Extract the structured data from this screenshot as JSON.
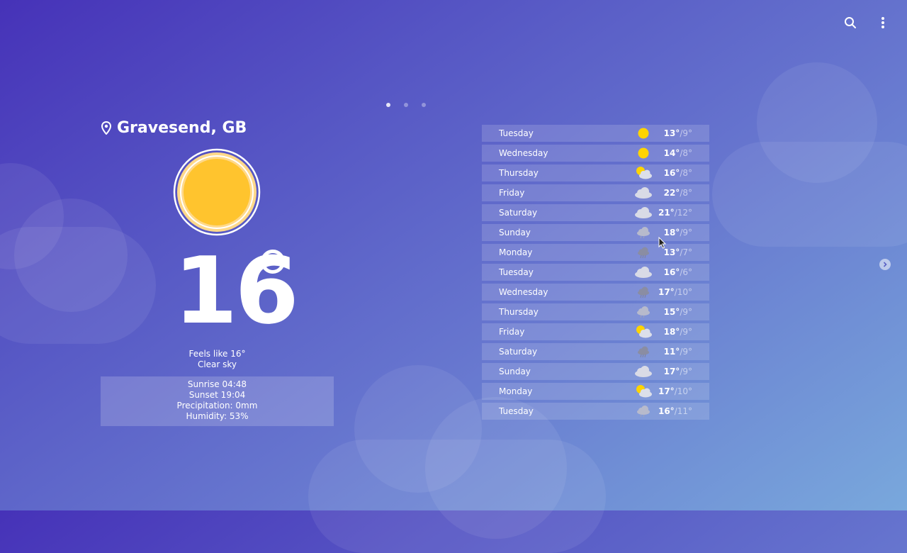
{
  "location": {
    "name": "Gravesend, GB"
  },
  "current": {
    "temperature": "16",
    "feels_like": "Feels like 16°",
    "condition": "Clear sky",
    "icon": "sun-icon"
  },
  "details": {
    "sunrise": "Sunrise 04:48",
    "sunset": "Sunset 19:04",
    "precipitation": "Precipitation: 0mm",
    "humidity": "Humidity: 53%"
  },
  "forecast": [
    {
      "day": "Tuesday",
      "hi": "13°",
      "lo": "/9°",
      "icon": "sun"
    },
    {
      "day": "Wednesday",
      "hi": "14°",
      "lo": "/8°",
      "icon": "sun"
    },
    {
      "day": "Thursday",
      "hi": "16°",
      "lo": "/8°",
      "icon": "sun-cloud"
    },
    {
      "day": "Friday",
      "hi": "22°",
      "lo": "/8°",
      "icon": "cloud"
    },
    {
      "day": "Saturday",
      "hi": "21°",
      "lo": "/12°",
      "icon": "cloud"
    },
    {
      "day": "Sunday",
      "hi": "18°",
      "lo": "/9°",
      "icon": "cloud-rain"
    },
    {
      "day": "Monday",
      "hi": "13°",
      "lo": "/7°",
      "icon": "cloud-dark-rain"
    },
    {
      "day": "Tuesday",
      "hi": "16°",
      "lo": "/6°",
      "icon": "cloud"
    },
    {
      "day": "Wednesday",
      "hi": "17°",
      "lo": "/10°",
      "icon": "cloud-dark-rain"
    },
    {
      "day": "Thursday",
      "hi": "15°",
      "lo": "/9°",
      "icon": "cloud-rain"
    },
    {
      "day": "Friday",
      "hi": "18°",
      "lo": "/9°",
      "icon": "sun-cloud"
    },
    {
      "day": "Saturday",
      "hi": "11°",
      "lo": "/9°",
      "icon": "cloud-dark-rain"
    },
    {
      "day": "Sunday",
      "hi": "17°",
      "lo": "/9°",
      "icon": "cloud"
    },
    {
      "day": "Monday",
      "hi": "17°",
      "lo": "/10°",
      "icon": "sun-cloud"
    },
    {
      "day": "Tuesday",
      "hi": "16°",
      "lo": "/11°",
      "icon": "cloud-rain"
    }
  ],
  "pager": {
    "count": 3,
    "active": 0
  },
  "colors": {
    "sun": "#ffc42e",
    "sun_ring": "#ffd98a",
    "cloud": "#d9dbe6",
    "dark_cloud": "#8a8da3"
  }
}
